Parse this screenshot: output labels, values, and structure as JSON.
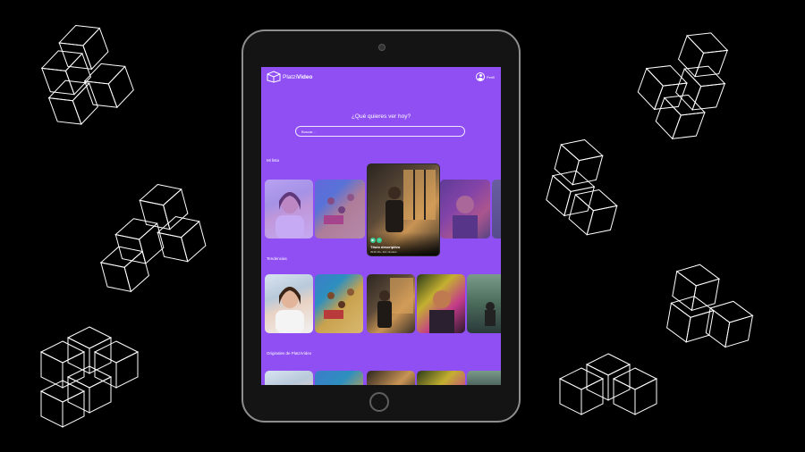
{
  "app": {
    "brand_prefix": "Platzi",
    "brand_suffix": "Video",
    "profile_label": "Perfil"
  },
  "hero": {
    "title": "¿Qué quieres ver hoy?",
    "search_placeholder": "Buscar..."
  },
  "sections": [
    {
      "title": "Mi lista",
      "cards": [
        {
          "image": "woman-smiling-phone",
          "state": "dimmed"
        },
        {
          "image": "beach-friends-aerial",
          "state": "dimmed"
        },
        {
          "image": "man-window-city",
          "state": "hovered",
          "title": "Título descriptivo",
          "subtitle": "2019 16+ 114 minutos"
        },
        {
          "image": "man-colored-smoke",
          "state": "dimmed"
        },
        {
          "image": "forest-hiker",
          "state": "dimmed"
        }
      ]
    },
    {
      "title": "Tendencias",
      "cards": [
        {
          "image": "woman-smiling-phone"
        },
        {
          "image": "beach-friends-aerial"
        },
        {
          "image": "man-window-city"
        },
        {
          "image": "man-colored-smoke"
        },
        {
          "image": "forest-hiker"
        }
      ]
    },
    {
      "title": "Originales de PlatziVideo",
      "cards": [
        {
          "image": "woman-smiling-phone"
        },
        {
          "image": "beach-friends-aerial"
        },
        {
          "image": "man-window-city"
        },
        {
          "image": "man-colored-smoke"
        },
        {
          "image": "forest-hiker"
        }
      ]
    }
  ],
  "colors": {
    "background": "#000000",
    "screen": "#8f4ff3",
    "accent": "#35c98e",
    "device_frame": "#141414"
  },
  "icons": {
    "logo": "platzivideo-cube-logo-icon",
    "profile": "user-circle-icon",
    "play": "play-icon",
    "add": "plus-icon",
    "decoration": "isometric-cubes-icon"
  }
}
